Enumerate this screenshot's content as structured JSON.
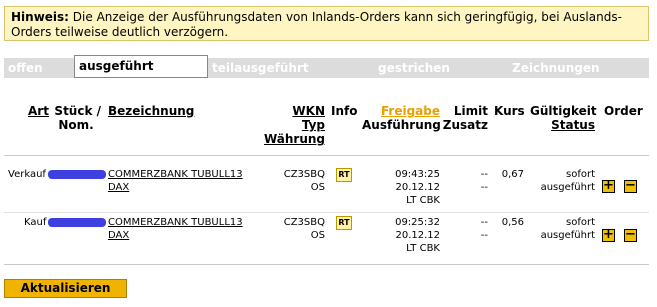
{
  "notice": {
    "label": "Hinweis:",
    "text": " Die Anzeige der Ausführungsdaten von Inlands-Orders kann sich geringfügig, bei Auslands-Orders teilweise deutlich verzögern."
  },
  "tabs": [
    "offen",
    "ausgeführt",
    "teilausgeführt",
    "gestrichen",
    "Zeichnungen"
  ],
  "active_tab": "ausgeführt",
  "headers": {
    "art": "Art",
    "stueck": "Stück /",
    "nom": "Nom.",
    "bezeichnung": "Bezeichnung",
    "wkn": "WKN",
    "typ": "Typ",
    "waehrung": "Währung",
    "info": "Info",
    "freigabe": "Freigabe",
    "ausfuehrung": "Ausführung",
    "limit": "Limit",
    "zusatz": "Zusatz",
    "kurs": "Kurs",
    "gueltigkeit": "Gültigkeit",
    "status": "Status",
    "order": "Order"
  },
  "rows": [
    {
      "art": "Verkauf",
      "bezeichnung_1": "COMMERZBANK TUBULL13",
      "bezeichnung_2": "DAX",
      "wkn": "CZ3SBQ",
      "typ": "OS",
      "info": "RT",
      "time": "09:43:25",
      "date": "20.12.12",
      "venue": "LT CBK",
      "limit": "--",
      "zusatz": "--",
      "kurs": "0,67",
      "gueltigkeit": "sofort",
      "status": "ausgeführt",
      "plus": "+",
      "minus": "−"
    },
    {
      "art": "Kauf",
      "bezeichnung_1": "COMMERZBANK TUBULL13",
      "bezeichnung_2": "DAX",
      "wkn": "CZ3SBQ",
      "typ": "OS",
      "info": "RT",
      "time": "09:25:32",
      "date": "20.12.12",
      "venue": "LT CBK",
      "limit": "--",
      "zusatz": "--",
      "kurs": "0,56",
      "gueltigkeit": "sofort",
      "status": "ausgeführt",
      "plus": "+",
      "minus": "−"
    }
  ],
  "refresh_label": "Aktualisieren",
  "colors": {
    "accent": "#f0b400",
    "notice_bg": "#fff5c2",
    "redaction": "#3f3fe0"
  }
}
